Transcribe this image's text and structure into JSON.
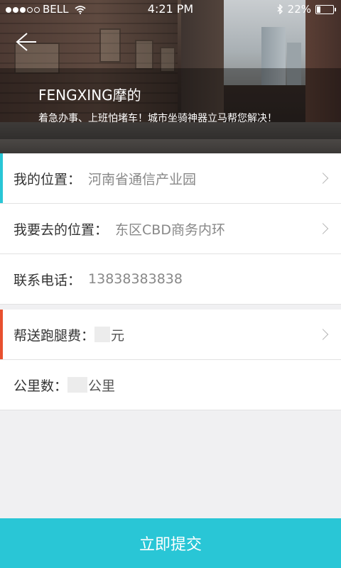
{
  "status_bar": {
    "carrier": "BELL",
    "time": "4:21 PM",
    "battery": "22%"
  },
  "header": {
    "title": "FENGXING摩的",
    "subtitle": "着急办事、上班怕堵车！城市坐骑神器立马帮您解决！",
    "back_icon": "back-arrow-icon"
  },
  "form": {
    "my_location": {
      "label": "我的位置：",
      "value": "河南省通信产业园"
    },
    "destination": {
      "label": "我要去的位置：",
      "value": "东区CBD商务内环"
    },
    "phone": {
      "label": "联系电话：",
      "value": "13838383838"
    },
    "fee": {
      "label": "帮送跑腿费：",
      "unit": "元"
    },
    "distance": {
      "label": "公里数：",
      "unit": "公里"
    }
  },
  "submit": {
    "label": "立即提交"
  },
  "colors": {
    "accent_cyan": "#29c6d6",
    "accent_red": "#e8502f"
  }
}
